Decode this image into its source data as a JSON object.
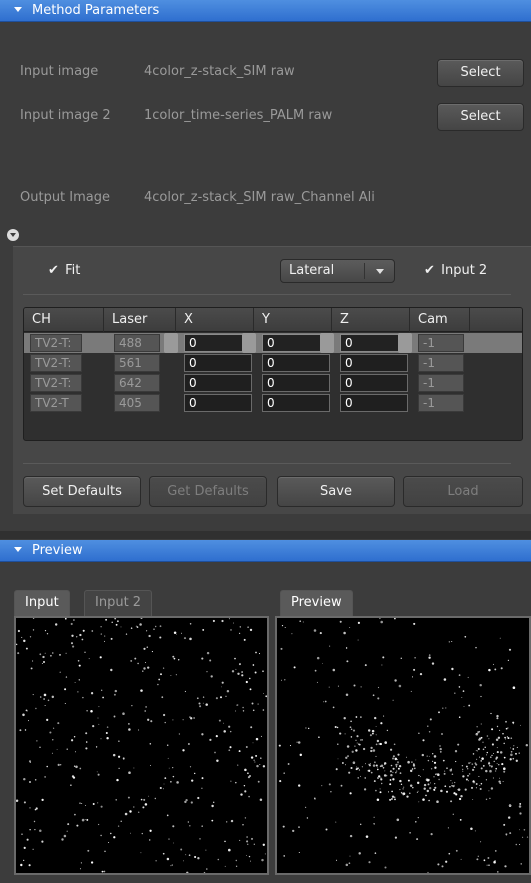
{
  "method_parameters": {
    "title": "Method Parameters",
    "input_image_label": "Input image",
    "input_image_value": "4color_z-stack_SIM raw",
    "input_image2_label": "Input image 2",
    "input_image2_value": "1color_time-series_PALM raw",
    "output_image_label": "Output Image",
    "output_image_value": "4color_z-stack_SIM raw_Channel Ali",
    "select_label": "Select"
  },
  "fit": {
    "label": "Fit",
    "checked": true
  },
  "mode": {
    "value": "Lateral"
  },
  "input2": {
    "label": "Input 2",
    "checked": true
  },
  "table": {
    "headers": [
      "CH",
      "Laser",
      "X",
      "Y",
      "Z",
      "Cam"
    ],
    "rows": [
      {
        "ch": "TV2-T:",
        "laser": "488",
        "x": "0",
        "y": "0",
        "z": "0",
        "cam": "-1"
      },
      {
        "ch": "TV2-T:",
        "laser": "561",
        "x": "0",
        "y": "0",
        "z": "0",
        "cam": "-1"
      },
      {
        "ch": "TV2-T:",
        "laser": "642",
        "x": "0",
        "y": "0",
        "z": "0",
        "cam": "-1"
      },
      {
        "ch": "TV2-T",
        "laser": "405",
        "x": "0",
        "y": "0",
        "z": "0",
        "cam": "-1"
      }
    ]
  },
  "buttons": {
    "set_defaults": "Set Defaults",
    "get_defaults": "Get Defaults",
    "save": "Save",
    "load": "Load"
  },
  "preview": {
    "title": "Preview",
    "left_tabs": [
      "Input",
      "Input 2"
    ],
    "right_tabs": [
      "Preview"
    ]
  },
  "icons": {
    "collapse": "chevron-down-icon",
    "checkbox": "checkmark-icon"
  },
  "colors": {
    "header_blue": "#3a7bd8",
    "panel_bg": "#3c3c3c"
  }
}
